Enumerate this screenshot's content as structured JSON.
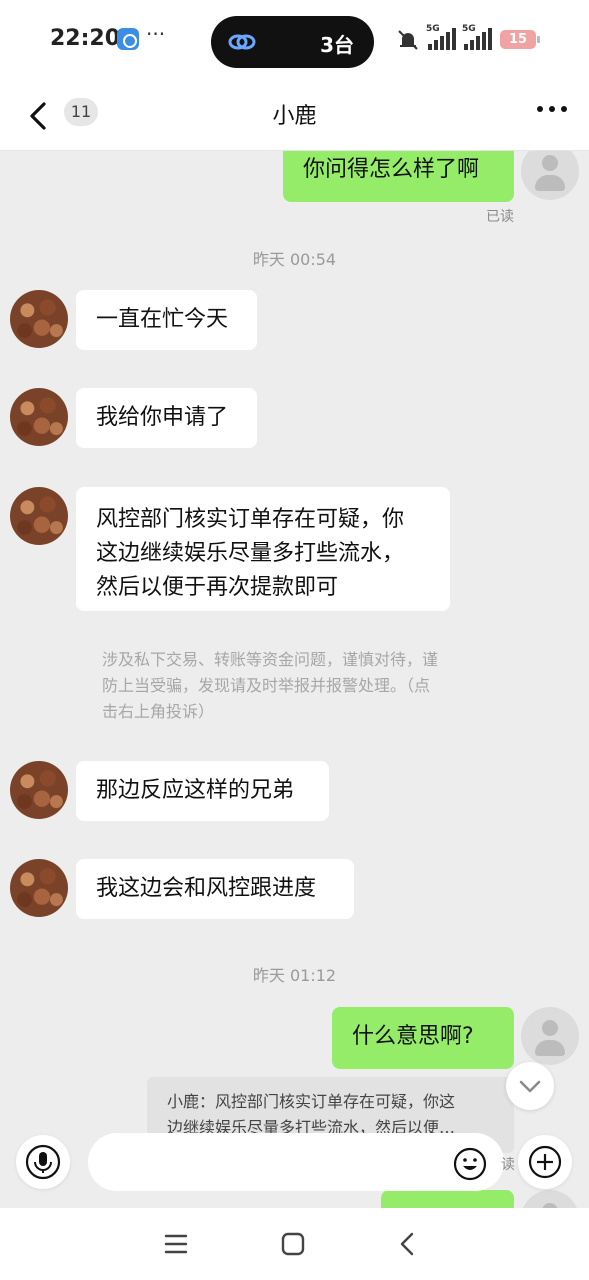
{
  "status_bar": {
    "time": "22:20",
    "more": "···",
    "island_text": "3台",
    "signal_1": "5G",
    "signal_2": "5G",
    "battery": "15"
  },
  "nav": {
    "unread_count": "11",
    "title": "小鹿"
  },
  "messages": {
    "m1": "你问得怎么样了啊",
    "m1_read": "已读",
    "ts1": "昨天 00:54",
    "m2": "一直在忙今天",
    "m3": "我给你申请了",
    "m4_line1": "风控部门核实订单存在可疑，你",
    "m4_line2": "这边继续娱乐尽量多打些流水，",
    "m4_line3": "然后以便于再次提款即可",
    "notice_line1": "涉及私下交易、转账等资金问题，谨慎对待，谨",
    "notice_line2": "防上当受骗，发现请及时举报并报警处理。（点",
    "notice_line3": "击右上角投诉）",
    "m5": "那边反应这样的兄弟",
    "m6": "我这边会和风控跟进度",
    "ts2": "昨天 01:12",
    "m7": "什么意思啊?",
    "quote_line1": "小鹿：风控部门核实订单存在可疑，你这",
    "quote_line2": "边继续娱乐尽量多打些流水，然后以便…",
    "m8_read_partial": "读"
  },
  "input": {
    "placeholder": ""
  },
  "colors": {
    "outgoing_bubble": "#95ec69",
    "incoming_bubble": "#ffffff",
    "chat_background": "#ededed"
  },
  "icons": [
    "back-icon",
    "more-icon",
    "microphone-icon",
    "emoji-icon",
    "plus-icon",
    "chevron-down-icon",
    "menu-icon",
    "home-icon",
    "back-nav-icon"
  ]
}
